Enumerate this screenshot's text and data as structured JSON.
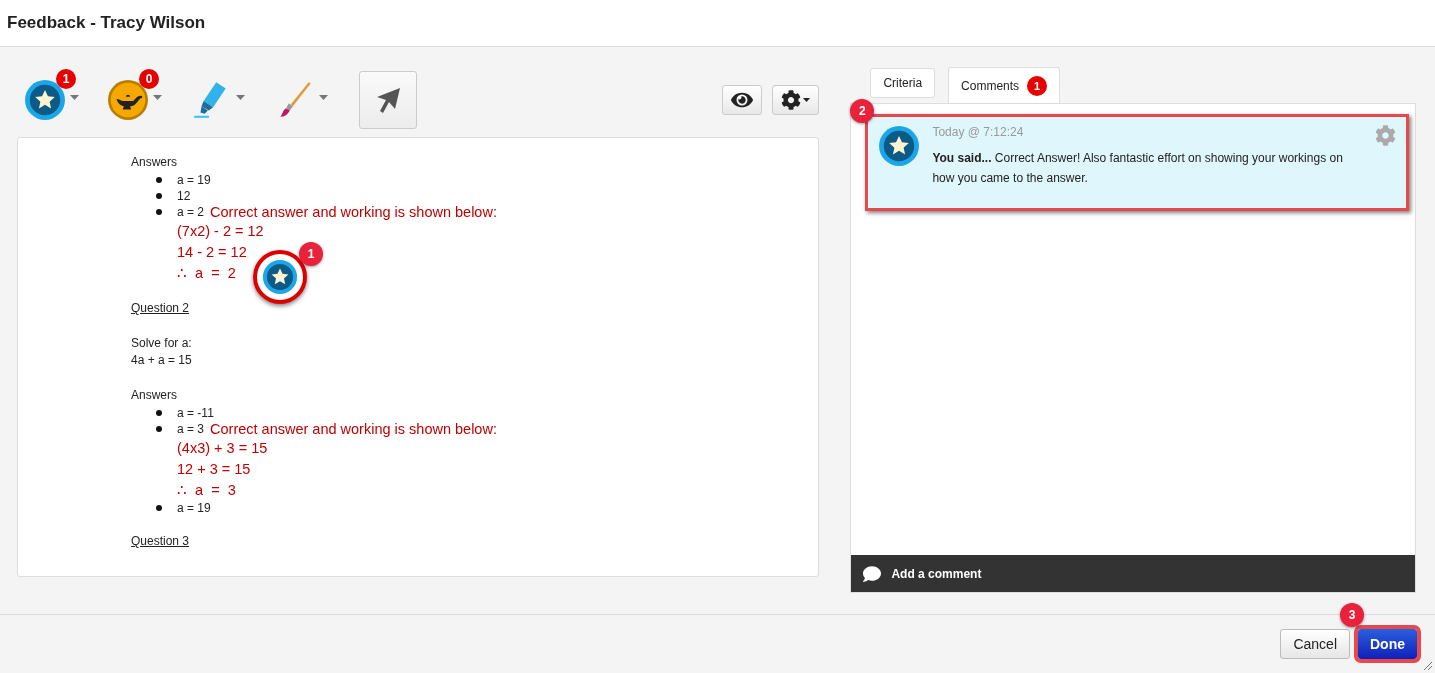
{
  "window": {
    "title": "Feedback - Tracy Wilson"
  },
  "toolbar": {
    "tools": [
      {
        "kind": "star",
        "badge": "1",
        "selected": false
      },
      {
        "kind": "lamp",
        "badge": "0",
        "selected": false
      },
      {
        "kind": "highlighter",
        "selected": false
      },
      {
        "kind": "brush",
        "selected": false
      },
      {
        "kind": "pointer",
        "selected": true
      }
    ]
  },
  "document": {
    "lines": [
      {
        "kind": "section",
        "text": "Answers"
      },
      {
        "kind": "bullet",
        "text": "a = 19"
      },
      {
        "kind": "bullet",
        "text": "12"
      },
      {
        "kind": "bullet",
        "text": "a = 2",
        "note": "Correct answer and working is shown below:"
      },
      {
        "kind": "working",
        "text": "(7x2) - 2 = 12"
      },
      {
        "kind": "working",
        "text": "14 - 2 = 12"
      },
      {
        "kind": "working",
        "text": "∴  a  =  2",
        "stamp": {
          "badge": "1"
        }
      },
      {
        "kind": "heading",
        "text": "Question 2"
      },
      {
        "kind": "plain",
        "text": "Solve for a:"
      },
      {
        "kind": "plain",
        "text": "4a + a = 15"
      },
      {
        "kind": "section",
        "text": "Answers"
      },
      {
        "kind": "bullet",
        "text": "a = -11"
      },
      {
        "kind": "bullet",
        "text": "a = 3",
        "note": "Correct answer and working is shown below:"
      },
      {
        "kind": "working",
        "text": "(4x3) + 3 = 15"
      },
      {
        "kind": "working",
        "text": "12 + 3 = 15"
      },
      {
        "kind": "working",
        "text": "∴  a  =  3"
      },
      {
        "kind": "bullet",
        "text": "a = 19"
      },
      {
        "kind": "heading",
        "text": "Question 3"
      }
    ]
  },
  "tabs": [
    {
      "label": "Criteria",
      "selected": false
    },
    {
      "label": "Comments",
      "selected": true,
      "badge": "1"
    }
  ],
  "comment": {
    "callout": "2",
    "time": "Today @ 7:12:24",
    "text": "**You said...** Correct Answer! Also fantastic effort on showing your workings on how you came to the answer."
  },
  "add_comment": {
    "label": "Add a comment"
  },
  "footer": {
    "buttons": [
      {
        "kind": "cancel",
        "label": "Cancel"
      },
      {
        "kind": "done",
        "label": "Done",
        "callout": "3"
      }
    ]
  }
}
